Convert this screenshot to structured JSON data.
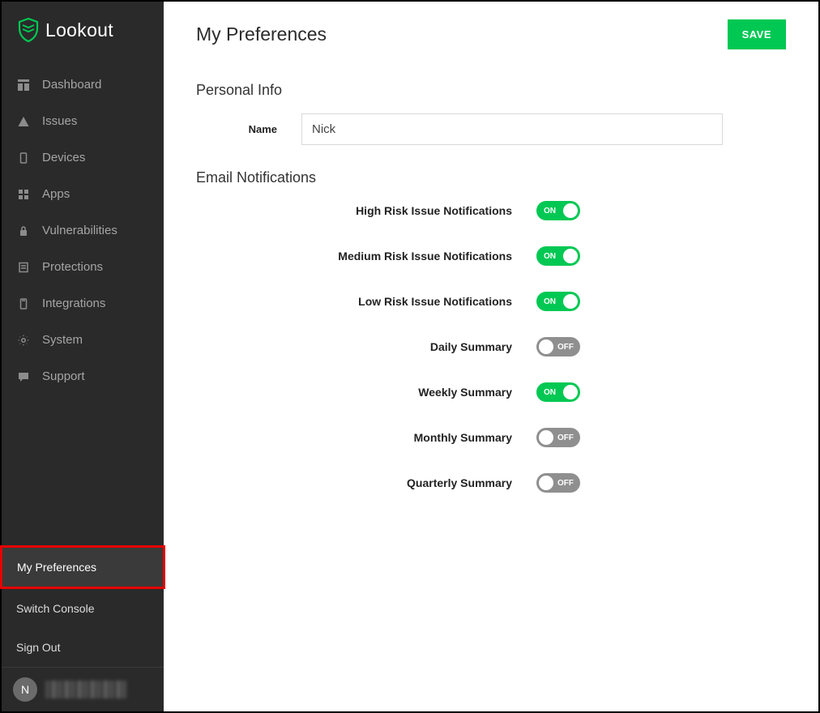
{
  "brand": "Lookout",
  "sidebar": {
    "items": [
      {
        "label": "Dashboard"
      },
      {
        "label": "Issues"
      },
      {
        "label": "Devices"
      },
      {
        "label": "Apps"
      },
      {
        "label": "Vulnerabilities"
      },
      {
        "label": "Protections"
      },
      {
        "label": "Integrations"
      },
      {
        "label": "System"
      },
      {
        "label": "Support"
      }
    ],
    "bottom": [
      {
        "label": "My Preferences",
        "selected": true
      },
      {
        "label": "Switch Console"
      },
      {
        "label": "Sign Out"
      }
    ],
    "user_initial": "N"
  },
  "header": {
    "title": "My Preferences",
    "save_label": "SAVE"
  },
  "sections": {
    "personal_info": {
      "title": "Personal Info",
      "name_label": "Name",
      "name_value": "Nick"
    },
    "email_notifications": {
      "title": "Email Notifications",
      "on_text": "ON",
      "off_text": "OFF",
      "toggles": [
        {
          "label": "High Risk Issue Notifications",
          "on": true
        },
        {
          "label": "Medium Risk Issue Notifications",
          "on": true
        },
        {
          "label": "Low Risk Issue Notifications",
          "on": true
        },
        {
          "label": "Daily Summary",
          "on": false
        },
        {
          "label": "Weekly Summary",
          "on": true
        },
        {
          "label": "Monthly Summary",
          "on": false
        },
        {
          "label": "Quarterly Summary",
          "on": false
        }
      ]
    }
  }
}
